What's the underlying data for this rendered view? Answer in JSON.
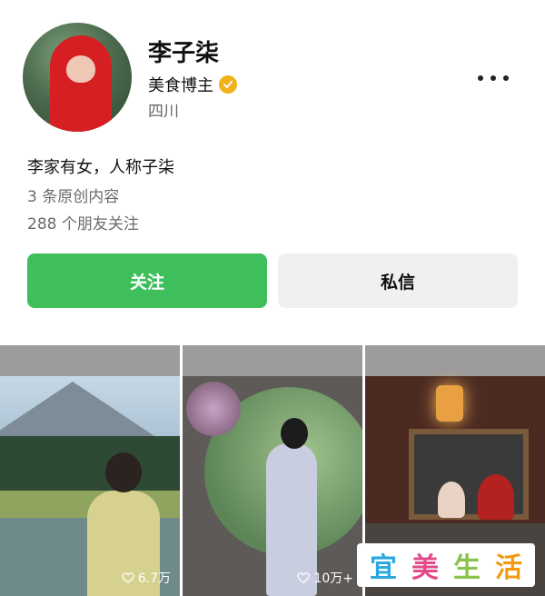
{
  "profile": {
    "name": "李子柒",
    "role": "美食博主",
    "location": "四川",
    "bio": "李家有女，人称子柒",
    "posts_stat": "3 条原创内容",
    "friends_stat": "288 个朋友关注"
  },
  "actions": {
    "follow_label": "关注",
    "message_label": "私信"
  },
  "posts": [
    {
      "likes": "6.7万"
    },
    {
      "likes": "10万+"
    },
    {
      "likes": ""
    }
  ],
  "watermark": {
    "chars": [
      "宜",
      "美",
      "生",
      "活"
    ],
    "colors": [
      "#2aa9e0",
      "#e24a8b",
      "#8bc34a",
      "#f39c12"
    ]
  },
  "colors": {
    "follow_green": "#3fbf5b",
    "verified_gold": "#f0b21b"
  },
  "icons": {
    "verified": "verified-badge-icon",
    "more": "more-dots-icon",
    "like": "heart-icon"
  }
}
